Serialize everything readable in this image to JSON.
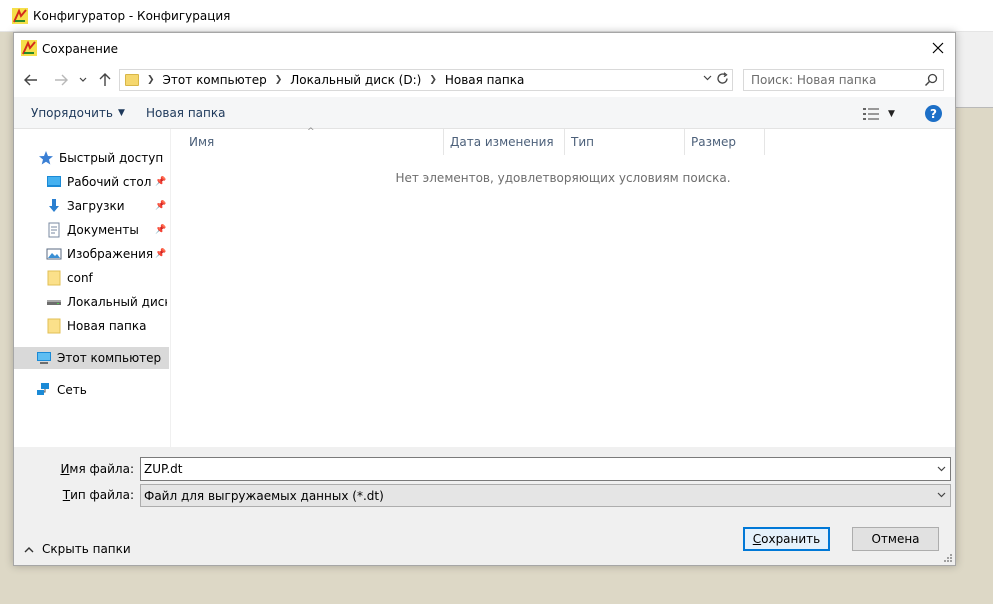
{
  "app": {
    "title": "Конфигуратор - Конфигурация"
  },
  "dialog": {
    "title": "Сохранение",
    "address": {
      "crumbs": [
        "Этот компьютер",
        "Локальный диск (D:)",
        "Новая папка"
      ]
    },
    "search": {
      "placeholder": "Поиск: Новая папка"
    },
    "toolbar": {
      "organize_label": "Упорядочить",
      "new_folder_label": "Новая папка"
    },
    "nav": {
      "quick_access": "Быстрый доступ",
      "desktop": "Рабочий стол",
      "downloads": "Загрузки",
      "documents": "Документы",
      "pictures": "Изображения",
      "conf": "conf",
      "local_disk": "Локальный диск (D:)",
      "new_folder": "Новая папка",
      "this_pc": "Этот компьютер",
      "network": "Сеть"
    },
    "columns": {
      "name": "Имя",
      "date": "Дата изменения",
      "type": "Тип",
      "size": "Размер"
    },
    "empty_message": "Нет элементов, удовлетворяющих условиям поиска.",
    "form": {
      "filename_label_prefix": "И",
      "filename_label_rest": "мя файла:",
      "filename_value": "ZUP.dt",
      "filetype_label_prefix": "Т",
      "filetype_label_rest": "ип файла:",
      "filetype_value": "Файл для выгружаемых данных (*.dt)",
      "hide_folders_label": "Скрыть папки",
      "save_label_prefix": "С",
      "save_label_rest": "охранить",
      "cancel_label": "Отмена"
    }
  }
}
